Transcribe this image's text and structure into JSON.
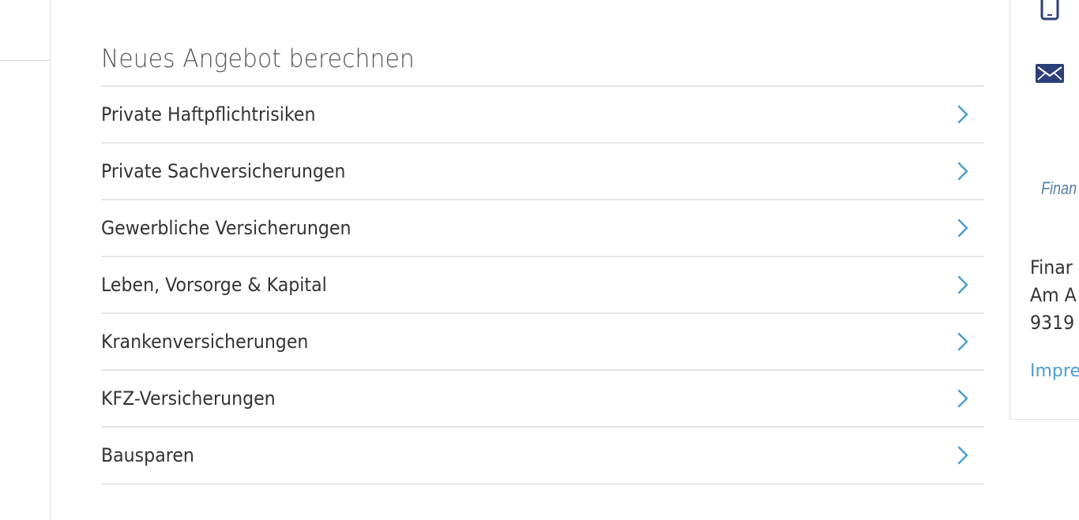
{
  "main": {
    "section_title": "Neues Angebot berechnen",
    "menu_items": [
      {
        "label": "Private Haftpflichtrisiken",
        "icon": "chevron-right-icon"
      },
      {
        "label": "Private Sachversicherungen",
        "icon": "chevron-right-icon"
      },
      {
        "label": "Gewerbliche Versicherungen",
        "icon": "chevron-right-icon"
      },
      {
        "label": "Leben, Vorsorge & Kapital",
        "icon": "chevron-right-icon"
      },
      {
        "label": "Krankenversicherungen",
        "icon": "chevron-right-icon"
      },
      {
        "label": "KFZ-Versicherungen",
        "icon": "chevron-right-icon"
      },
      {
        "label": "Bausparen",
        "icon": "chevron-right-icon"
      }
    ]
  },
  "sidebar": {
    "icons": [
      "phone-icon",
      "mail-icon"
    ],
    "brand_fragment": "Finan",
    "address_lines": [
      "Finar",
      "Am A",
      "9319"
    ],
    "imprint_link": "Impre"
  },
  "colors": {
    "accent": "#4a9fd0",
    "icon_navy": "#2b3f7a",
    "divider": "#e6e6e6"
  }
}
